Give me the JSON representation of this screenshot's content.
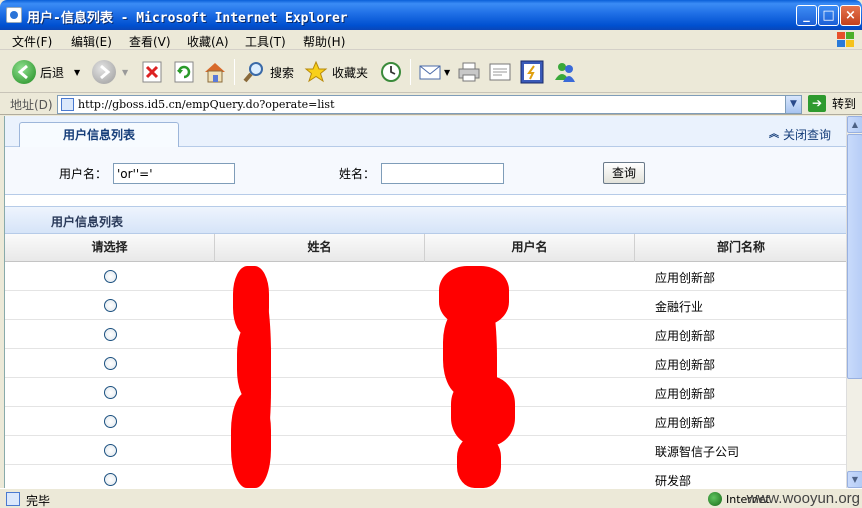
{
  "window": {
    "title": "用户-信息列表 - Microsoft Internet Explorer",
    "buttons": {
      "minimize": "_",
      "maximize": "□",
      "close": "×"
    }
  },
  "menu": [
    "文件(F)",
    "编辑(E)",
    "查看(V)",
    "收藏(A)",
    "工具(T)",
    "帮助(H)"
  ],
  "toolbar": {
    "back": "后退",
    "search": "搜索",
    "favorites": "收藏夹"
  },
  "address": {
    "label": "地址(D)",
    "url": "http://gboss.id5.cn/empQuery.do?operate=list",
    "go": "转到"
  },
  "page": {
    "tab": "用户信息列表",
    "close_query": "关闭查询",
    "search": {
      "username_label": "用户名：",
      "username_value": "'or''='",
      "name_label": "姓名：",
      "name_value": "",
      "query_button": "查询"
    },
    "section_title": "用户信息列表",
    "columns": [
      "请选择",
      "姓名",
      "用户名",
      "部门名称"
    ],
    "rows": [
      {
        "dept": "应用创新部"
      },
      {
        "dept": "金融行业"
      },
      {
        "dept": "应用创新部"
      },
      {
        "dept": "应用创新部"
      },
      {
        "dept": "应用创新部"
      },
      {
        "dept": "应用创新部"
      },
      {
        "dept": "联源智信子公司"
      },
      {
        "dept": "研发部"
      }
    ]
  },
  "status": {
    "text": "完毕",
    "zone": "Internet",
    "watermark": "www.wooyun.org"
  },
  "colors": {
    "titlebar": "#0a56d6",
    "redaction": "#ff0000",
    "link": "#163e7a"
  }
}
